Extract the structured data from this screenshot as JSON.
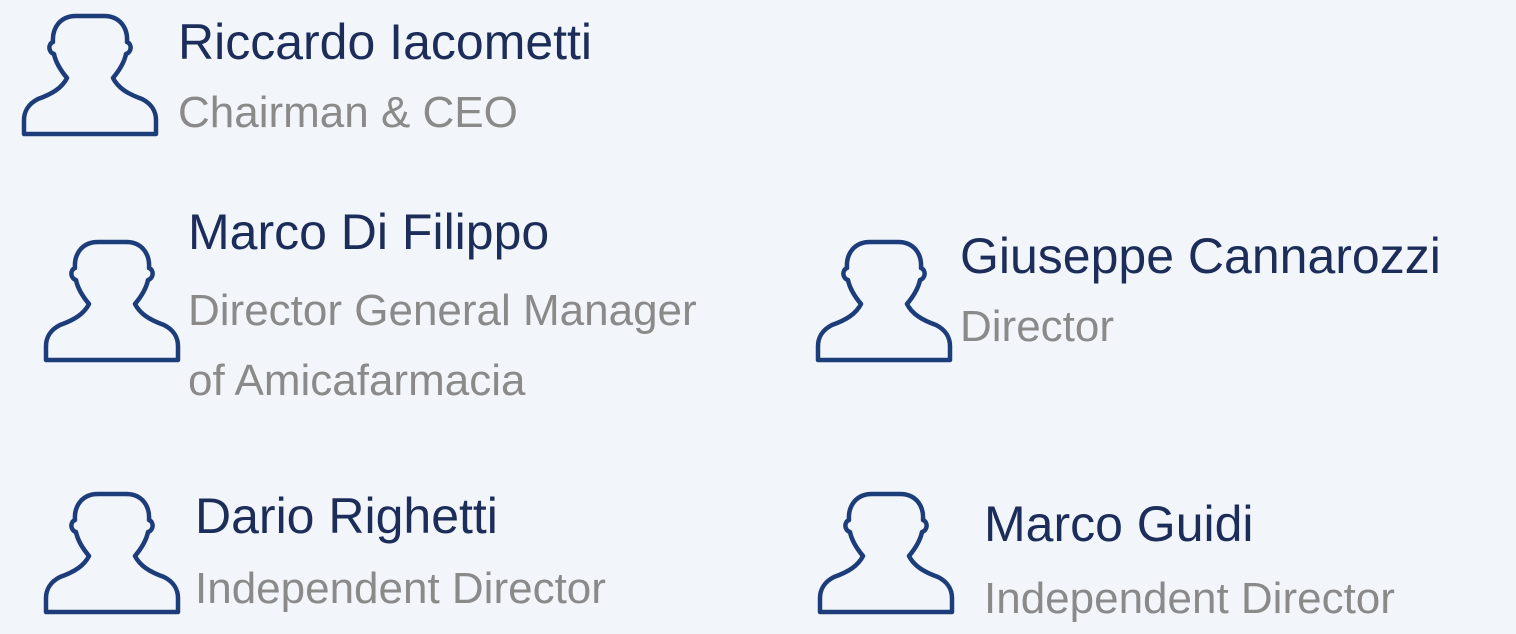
{
  "colors": {
    "background": "#f2f6fb",
    "name": "#1c2d5a",
    "role": "#8a8a8a",
    "icon_stroke": "#1c3d7a"
  },
  "people": [
    {
      "name": "Riccardo Iacometti",
      "role": "Chairman & CEO",
      "icon": "person-icon"
    },
    {
      "name": "Marco Di Filippo",
      "role": "Director General Manager\nof Amicafarmacia",
      "role_line1": "Director General Manager",
      "role_line2": "of Amicafarmacia",
      "icon": "person-icon"
    },
    {
      "name": "Giuseppe Cannarozzi",
      "role": "Director",
      "icon": "person-icon"
    },
    {
      "name": "Dario Righetti",
      "role": "Independent Director",
      "icon": "person-icon"
    },
    {
      "name": "Marco Guidi",
      "role": "Independent Director",
      "icon": "person-icon"
    }
  ]
}
